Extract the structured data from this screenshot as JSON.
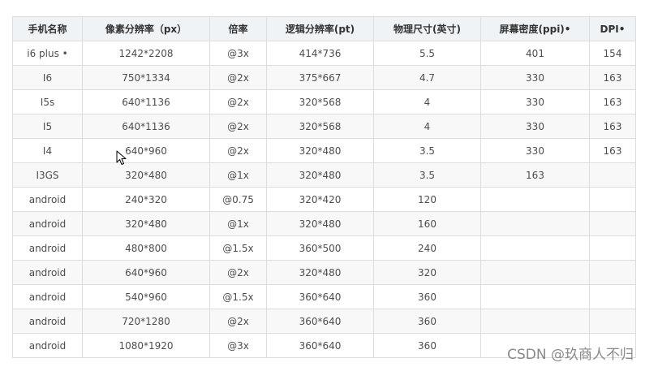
{
  "table": {
    "headers": [
      "手机名称",
      "像素分辨率（px）",
      "倍率",
      "逻辑分辨率(pt)",
      "物理尺寸(英寸)",
      "屏幕密度(ppi)•",
      "DPI•"
    ],
    "rows": [
      [
        "i6 plus •",
        "1242*2208",
        "@3x",
        "414*736",
        "5.5",
        "401",
        "154"
      ],
      [
        "I6",
        "750*1334",
        "@2x",
        "375*667",
        "4.7",
        "330",
        "163"
      ],
      [
        "I5s",
        "640*1136",
        "@2x",
        "320*568",
        "4",
        "330",
        "163"
      ],
      [
        "I5",
        "640*1136",
        "@2x",
        "320*568",
        "4",
        "330",
        "163"
      ],
      [
        "I4",
        "640*960",
        "@2x",
        "320*480",
        "3.5",
        "330",
        "163"
      ],
      [
        "I3GS",
        "320*480",
        "@1x",
        "320*480",
        "3.5",
        "163",
        ""
      ],
      [
        "android",
        "240*320",
        "@0.75",
        "320*420",
        "120",
        "",
        ""
      ],
      [
        "android",
        "320*480",
        "@1x",
        "320*480",
        "160",
        "",
        ""
      ],
      [
        "android",
        "480*800",
        "@1.5x",
        "360*500",
        "240",
        "",
        ""
      ],
      [
        "android",
        "640*960",
        "@2x",
        "320*480",
        "320",
        "",
        ""
      ],
      [
        "android",
        "540*960",
        "@1.5x",
        "360*640",
        "360",
        "",
        ""
      ],
      [
        "android",
        "720*1280",
        "@2x",
        "360*640",
        "360",
        "",
        ""
      ],
      [
        "android",
        "1080*1920",
        "@3x",
        "360*640",
        "360",
        "",
        ""
      ]
    ]
  },
  "watermark": "CSDN @玖商人不归"
}
